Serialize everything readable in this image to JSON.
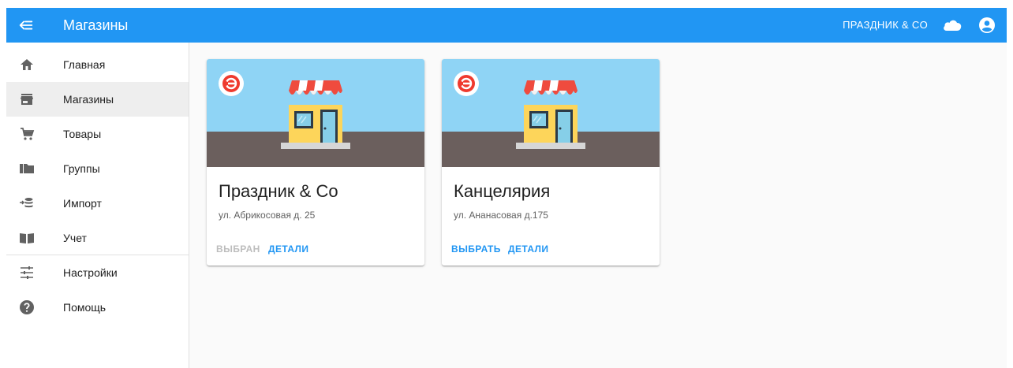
{
  "appbar": {
    "title": "Магазины",
    "store_name": "ПРАЗДНИК & CO",
    "icons": [
      "menu-open-icon",
      "cloud-icon",
      "account-circle-icon"
    ]
  },
  "sidebar": {
    "items": [
      {
        "label": "Главная",
        "icon": "home-icon",
        "active": false
      },
      {
        "label": "Магазины",
        "icon": "store-icon",
        "active": true
      },
      {
        "label": "Товары",
        "icon": "cart-icon",
        "active": false
      },
      {
        "label": "Группы",
        "icon": "folder-icon",
        "active": false
      },
      {
        "label": "Импорт",
        "icon": "import-icon",
        "active": false
      },
      {
        "label": "Учет",
        "icon": "book-icon",
        "active": false
      },
      {
        "label": "Настройки",
        "icon": "tune-icon",
        "active": false
      },
      {
        "label": "Помощь",
        "icon": "help-icon",
        "active": false
      }
    ]
  },
  "stores": [
    {
      "name": "Праздник & Co",
      "address": "ул. Абрикосовая д. 25",
      "select_label": "ВЫБРАН",
      "selected": true,
      "details_label": "ДЕТАЛИ"
    },
    {
      "name": "Канцелярия",
      "address": "ул. Ананасовая д.175",
      "select_label": "ВЫБРАТЬ",
      "selected": false,
      "details_label": "ДЕТАЛИ"
    }
  ],
  "colors": {
    "primary": "#2196f3",
    "sky": "#8fd4f5",
    "ground": "#6b5f5d",
    "awning_red": "#ef4b3e",
    "shop_yellow": "#fdd55a",
    "logo_red": "#ef3a2e"
  }
}
